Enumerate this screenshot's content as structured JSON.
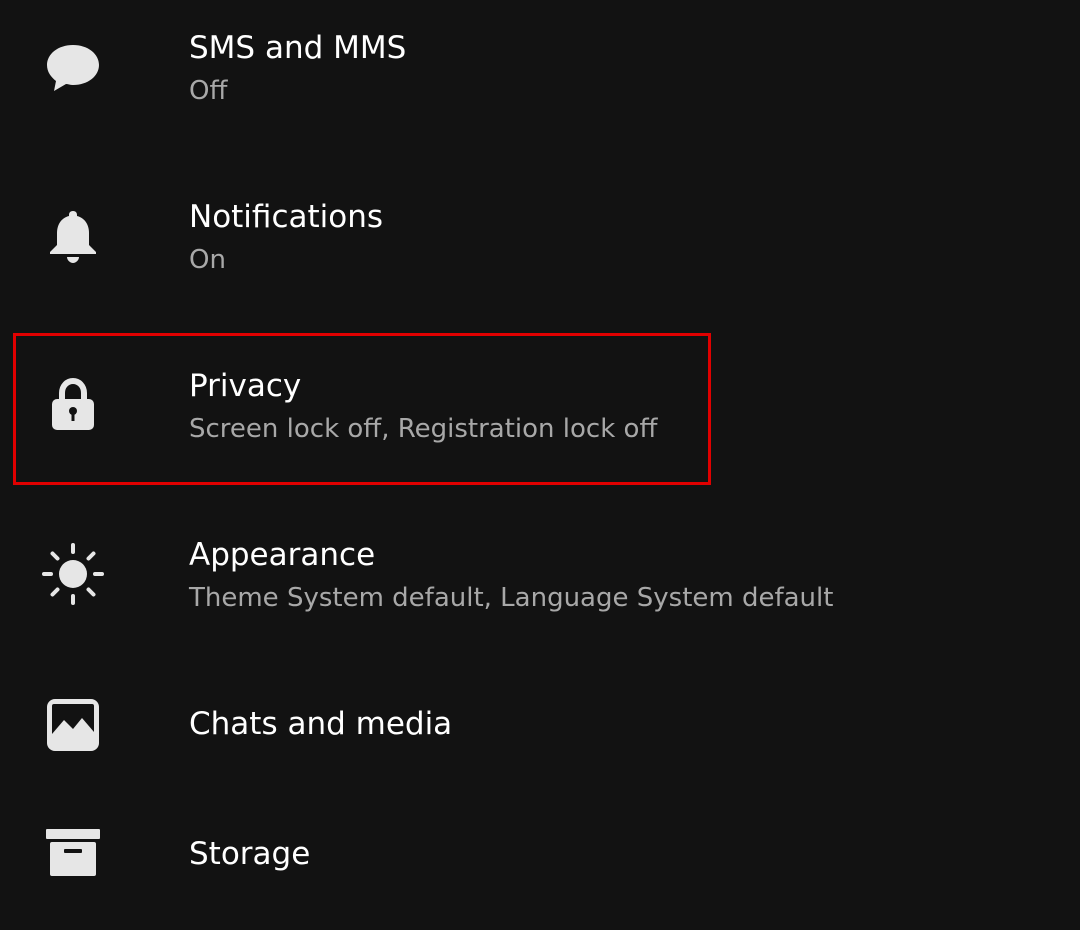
{
  "settings": {
    "items": [
      {
        "id": "sms",
        "title": "SMS and MMS",
        "subtitle": "Off",
        "icon": "chat-bubble-icon"
      },
      {
        "id": "notifications",
        "title": "Notifications",
        "subtitle": "On",
        "icon": "bell-icon"
      },
      {
        "id": "privacy",
        "title": "Privacy",
        "subtitle": "Screen lock off, Registration lock off",
        "icon": "lock-icon"
      },
      {
        "id": "appearance",
        "title": "Appearance",
        "subtitle": "Theme System default, Language System default",
        "icon": "sun-icon"
      },
      {
        "id": "chats",
        "title": "Chats and media",
        "subtitle": "",
        "icon": "image-icon"
      },
      {
        "id": "storage",
        "title": "Storage",
        "subtitle": "",
        "icon": "archive-box-icon"
      }
    ]
  },
  "colors": {
    "background": "#121212",
    "title_text": "#ffffff",
    "subtitle_text": "#a8a8a8",
    "icon": "#e6e6e6",
    "highlight_border": "#e00000"
  }
}
